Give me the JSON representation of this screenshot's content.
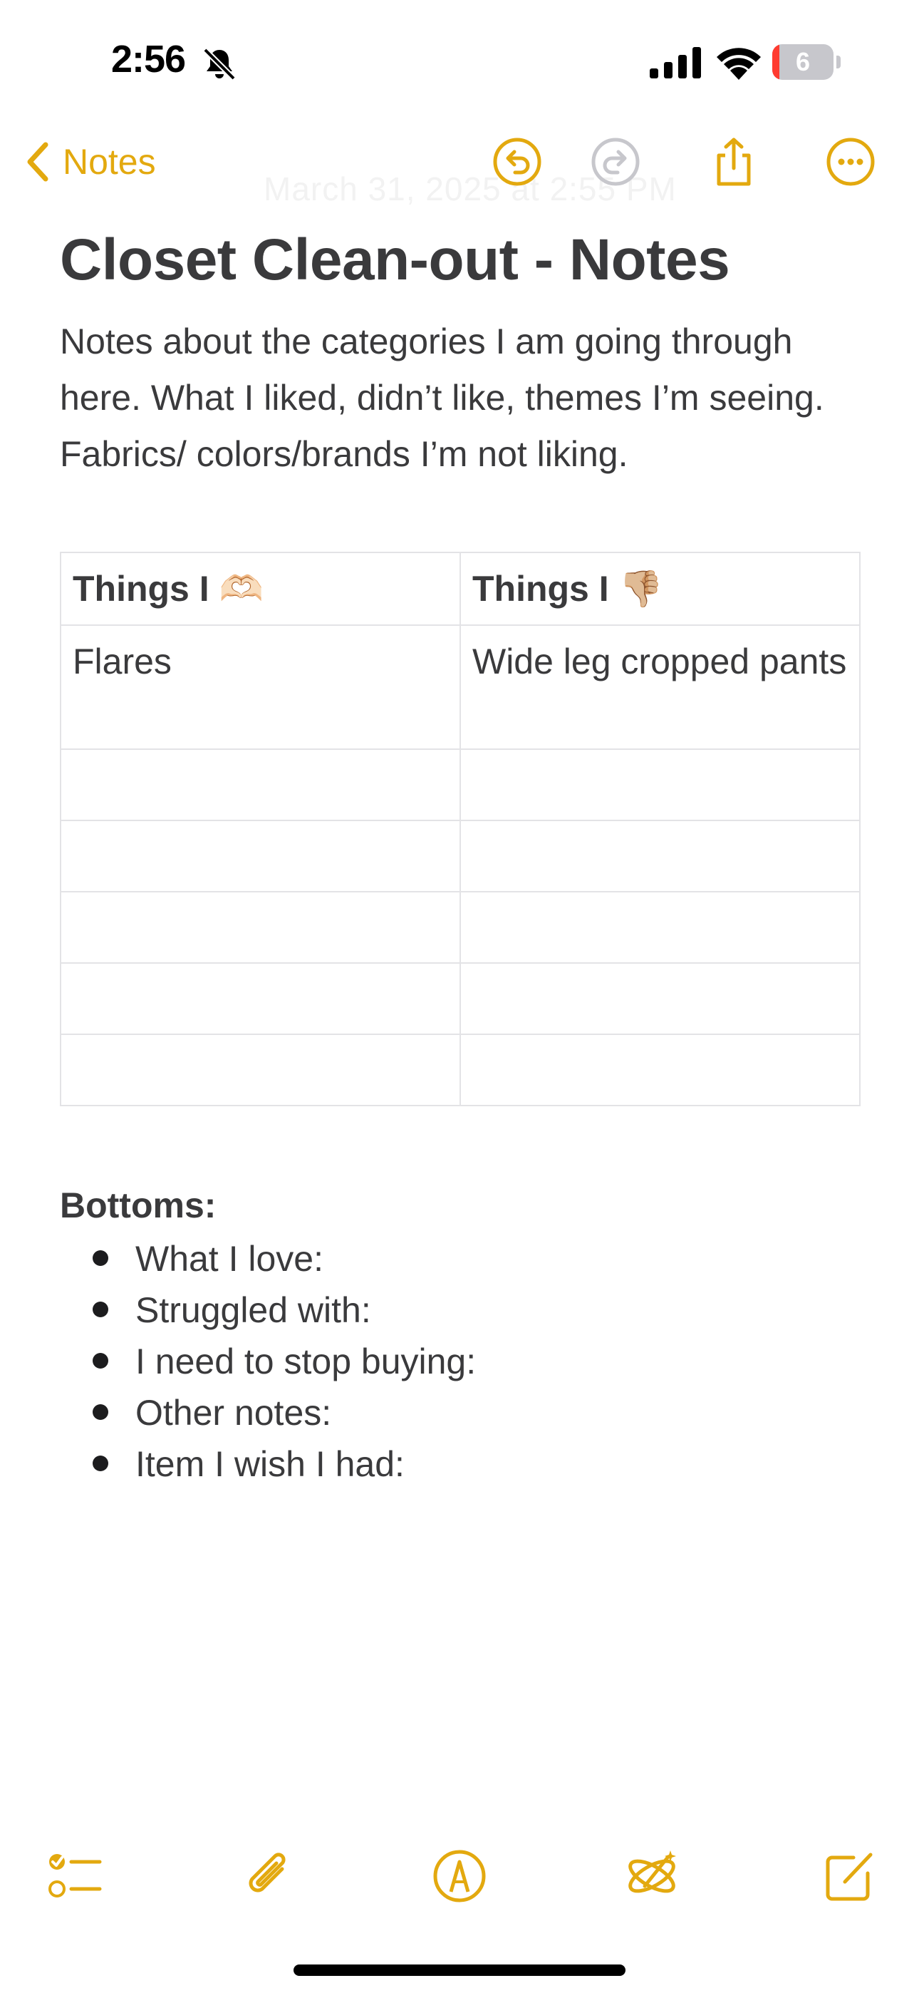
{
  "status_bar": {
    "time": "2:56",
    "battery_level": "6",
    "battery_fraction": 0.12
  },
  "nav": {
    "back_label": "Notes",
    "ghost_date": "March 31, 2025 at 2:55 PM"
  },
  "note": {
    "title": "Closet Clean-out - Notes",
    "intro": "Notes about the categories I am going through here. What I liked, didn’t like, themes I’m seeing. Fabrics/ colors/brands I’m not liking.",
    "table": {
      "headers": [
        "Things I 🫶🏻",
        "Things I 👎🏼"
      ],
      "rows": [
        [
          "Flares",
          " Wide leg cropped pants"
        ],
        [
          "",
          ""
        ],
        [
          "",
          ""
        ],
        [
          "",
          ""
        ],
        [
          "",
          ""
        ],
        [
          "",
          ""
        ]
      ]
    },
    "section_title": "Bottoms:",
    "bullets": [
      "What I love:",
      "Struggled with:",
      "I need to stop buying:",
      "Other notes:",
      "Item I wish I had:"
    ]
  },
  "colors": {
    "accent": "#e3a90f",
    "text": "#3a3a3c",
    "table_border": "#e3e3e6",
    "disabled": "#c7c7cc"
  },
  "icons": {
    "nav": [
      "chevron-left-icon",
      "undo-icon",
      "redo-icon",
      "share-icon",
      "more-icon"
    ],
    "toolbar": [
      "checklist-icon",
      "paperclip-icon",
      "markup-pen-icon",
      "writing-tools-icon",
      "compose-icon"
    ]
  }
}
